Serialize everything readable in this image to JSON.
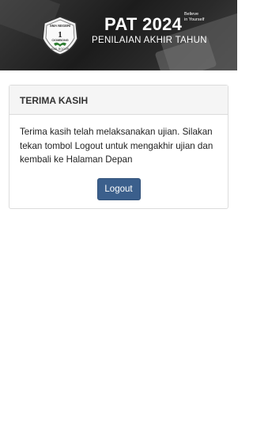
{
  "header": {
    "logo": {
      "icon": "school-logo-icon",
      "top_text": "SMA NEGERI",
      "number": "1",
      "name": "CIOMBONG",
      "bottom_text": "KAB. BOGOR"
    },
    "title": "PAT 2024",
    "tagline_line1": "Believe",
    "tagline_line2": "in Yourself",
    "subtitle": "PENILAIAN AKHIR TAHUN"
  },
  "card": {
    "title": "TERIMA KASIH",
    "message": "Terima kasih telah melaksanakan ujian. Silakan tekan tombol Logout untuk mengakhir ujian dan kembali ke Halaman Depan",
    "logout_label": "Logout"
  },
  "colors": {
    "button": "#3b5f8c",
    "card_header_bg": "#f5f5f5",
    "banner_bg": "#222222"
  }
}
